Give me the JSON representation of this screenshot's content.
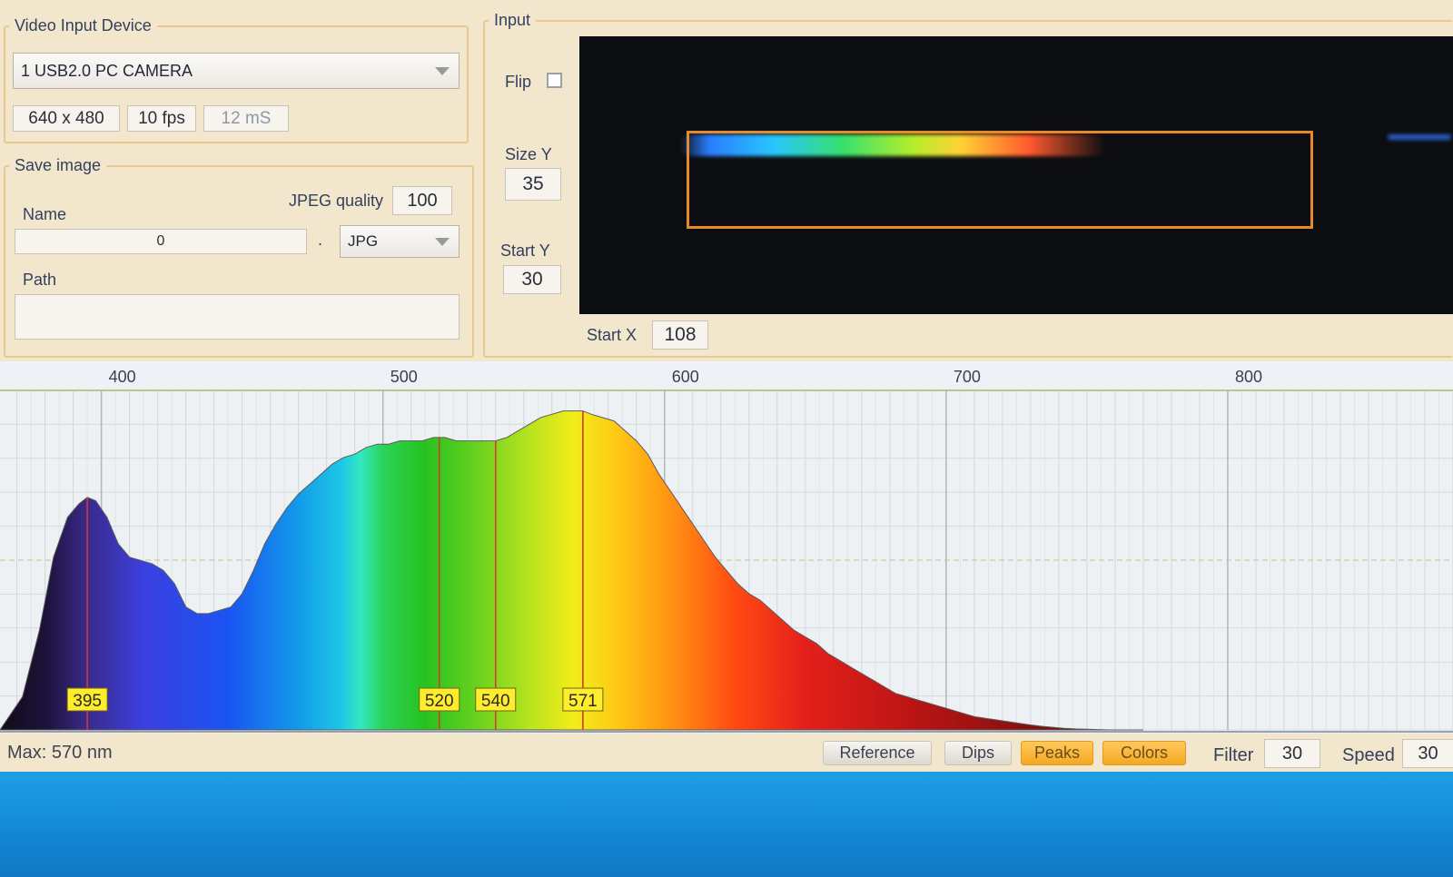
{
  "video_input": {
    "legend": "Video Input Device",
    "camera": "1 USB2.0 PC CAMERA",
    "resolution": "640 x 480",
    "fps": "10 fps",
    "exposure": "12 mS"
  },
  "save_image": {
    "legend": "Save image",
    "name_label": "Name",
    "name_value": "0",
    "jpeg_quality_label": "JPEG quality",
    "jpeg_quality": "100",
    "dot": ".",
    "format": "JPG",
    "path_label": "Path",
    "path_value": ""
  },
  "input": {
    "legend": "Input",
    "flip_label": "Flip",
    "flip_checked": false,
    "size_y_label": "Size Y",
    "size_y": "35",
    "start_y_label": "Start Y",
    "start_y": "30",
    "start_x_label": "Start X",
    "start_x": "108"
  },
  "chart_data": {
    "type": "area",
    "x_ticks": [
      400,
      500,
      600,
      700,
      800
    ],
    "xlim": [
      364,
      880
    ],
    "ylim": [
      0,
      100
    ],
    "x": [
      364,
      372,
      378,
      383,
      388,
      392,
      395,
      398,
      402,
      406,
      410,
      414,
      418,
      422,
      426,
      430,
      434,
      438,
      442,
      446,
      450,
      454,
      458,
      462,
      466,
      470,
      474,
      478,
      482,
      486,
      490,
      494,
      498,
      502,
      506,
      510,
      514,
      518,
      520,
      522,
      526,
      530,
      534,
      538,
      540,
      544,
      548,
      552,
      556,
      560,
      564,
      568,
      571,
      574,
      578,
      582,
      586,
      590,
      594,
      598,
      602,
      606,
      610,
      614,
      618,
      622,
      626,
      630,
      634,
      638,
      642,
      646,
      650,
      654,
      658,
      662,
      666,
      670,
      674,
      678,
      682,
      686,
      690,
      694,
      698,
      702,
      706,
      710,
      714,
      718,
      722,
      726,
      730,
      734,
      738,
      742,
      746,
      750,
      754,
      758,
      762,
      766,
      770
    ],
    "y": [
      0,
      10,
      30,
      52,
      64,
      68,
      70,
      69,
      64,
      56,
      52,
      51,
      50,
      48,
      44,
      37,
      35,
      35,
      36,
      37,
      41,
      48,
      56,
      62,
      67,
      71,
      74,
      77,
      80,
      82,
      83,
      85,
      86,
      86,
      87,
      87,
      87,
      88,
      88,
      88,
      87,
      87,
      87,
      87,
      87,
      88,
      90,
      92,
      94,
      95,
      96,
      96,
      96,
      95,
      94,
      93,
      90,
      87,
      83,
      77,
      72,
      67,
      62,
      57,
      52,
      48,
      44,
      41,
      39,
      36,
      33,
      30,
      28,
      26,
      23,
      21,
      19,
      17,
      15,
      13,
      11,
      10,
      9,
      8,
      7,
      6,
      5,
      4,
      3.5,
      3,
      2.5,
      2,
      1.5,
      1.1,
      0.8,
      0.5,
      0.3,
      0.2,
      0.1,
      0,
      0,
      0,
      0
    ],
    "peaks": [
      395,
      520,
      540,
      571
    ],
    "peak_labels": [
      "395",
      "520",
      "540",
      "571"
    ]
  },
  "status": {
    "max_text": "Max: 570 nm",
    "reference_label": "Reference",
    "dips_label": "Dips",
    "peaks_label": "Peaks",
    "colors_label": "Colors",
    "filter_label": "Filter",
    "filter_value": "30",
    "speed_label": "Speed",
    "speed_value": "30"
  },
  "colors": {
    "panel_bg": "#f2e6cc",
    "group_border": "#e8c98f",
    "chart_bg": "#eef1f3",
    "peak_line": "#d33a32",
    "peak_label_bg": "#ffec2a",
    "roi_border": "#e48a2a",
    "active_button": "#f8b533",
    "desktop": "#1488d6"
  }
}
